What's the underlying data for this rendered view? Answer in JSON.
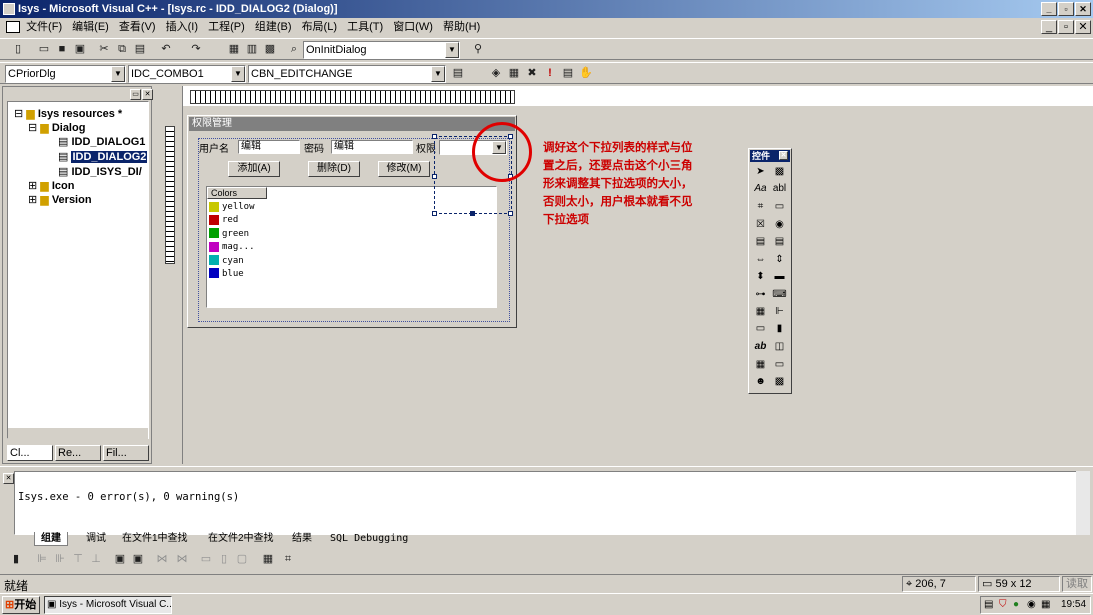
{
  "title": "Isys - Microsoft Visual C++ - [Isys.rc - IDD_DIALOG2 (Dialog)]",
  "menu": [
    "文件(F)",
    "编辑(E)",
    "查看(V)",
    "插入(I)",
    "工程(P)",
    "组建(B)",
    "布局(L)",
    "工具(T)",
    "窗口(W)",
    "帮助(H)"
  ],
  "toolbar": {
    "function_combo": "OnInitDialog"
  },
  "wizardbar": {
    "class_combo": "CPriorDlg",
    "id_combo": "IDC_COMBO1",
    "message_combo": "CBN_EDITCHANGE"
  },
  "workspace": {
    "root": "Isys resources *",
    "dialog_folder": "Dialog",
    "dialogs": [
      "IDD_DIALOG1",
      "IDD_DIALOG2",
      "IDD_ISYS_DI/"
    ],
    "icon_folder": "Icon",
    "version_folder": "Version",
    "tabs": [
      "Cl...",
      "Re...",
      "Fil..."
    ]
  },
  "dialog": {
    "title": "权限管理",
    "user_label": "用户名",
    "user_edit": "编辑",
    "pwd_label": "密码",
    "pwd_edit": "编辑",
    "perm_label": "权限",
    "add_btn": "添加(A)",
    "del_btn": "删除(D)",
    "mod_btn": "修改(M)",
    "list_header": "Colors",
    "list_items": [
      {
        "name": "yellow",
        "color": "#c8c800"
      },
      {
        "name": "red",
        "color": "#c00000"
      },
      {
        "name": "green",
        "color": "#00a000"
      },
      {
        "name": "mag...",
        "color": "#c000c0"
      },
      {
        "name": "cyan",
        "color": "#00b0b0"
      },
      {
        "name": "blue",
        "color": "#0000c0"
      }
    ]
  },
  "annotation": "调好这个下拉列表的样式与位置之后，还要点击这个小三角形来调整其下拉选项的大小，否则太小，用户根本就看不见下拉选项",
  "controls_toolbar": {
    "title": "控件"
  },
  "output": {
    "text": "Isys.exe - 0 error(s), 0 warning(s)",
    "tabs": [
      "组建",
      "调试",
      "在文件1中查找",
      "在文件2中查找",
      "结果",
      "SQL Debugging"
    ]
  },
  "status": {
    "text": "就绪",
    "position": "206, 7",
    "size": "59 x 12",
    "readonly": "读取"
  },
  "taskbar": {
    "start": "开始",
    "task": "Isys - Microsoft Visual C...",
    "clock": "19:54"
  },
  "colors": {
    "title_start": "#0a246a",
    "annotation": "#cc0000",
    "circle": "#e00000"
  }
}
